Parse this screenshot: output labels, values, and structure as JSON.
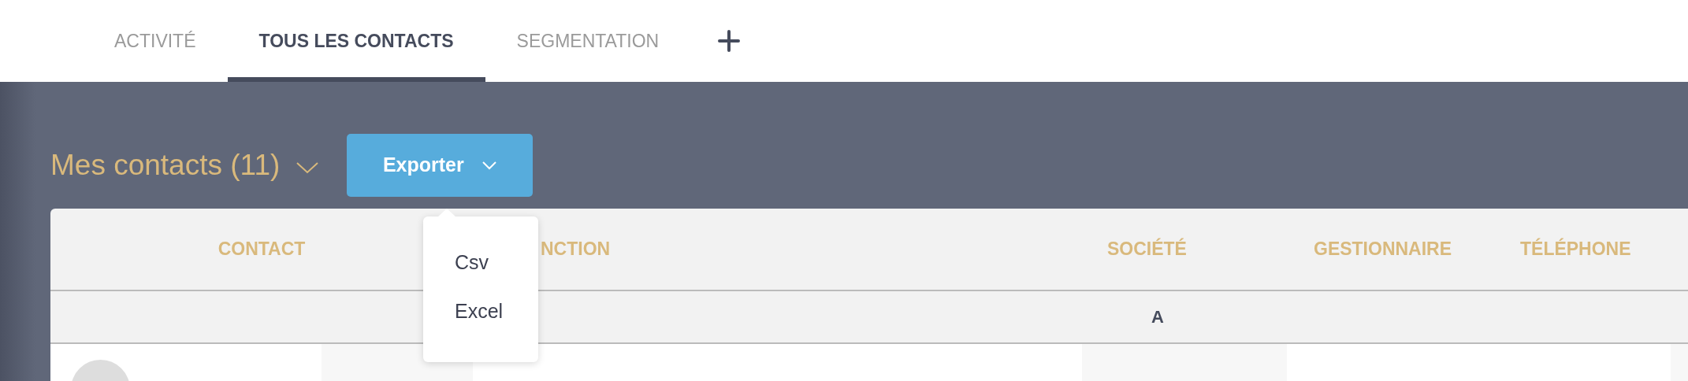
{
  "tabs": [
    {
      "label": "ACTIVITÉ",
      "selected": false
    },
    {
      "label": "TOUS LES CONTACTS",
      "selected": true
    },
    {
      "label": "SEGMENTATION",
      "selected": false
    }
  ],
  "list_selector": {
    "label": "Mes contacts (11)"
  },
  "export_button": {
    "label": "Exporter"
  },
  "export_menu": {
    "items": [
      "Csv",
      "Excel"
    ]
  },
  "table": {
    "columns": [
      "CONTACT",
      "NCTION",
      "SOCIÉTÉ",
      "GESTIONNAIRE",
      "TÉLÉPHONE"
    ],
    "groups": [
      {
        "letter": "A"
      }
    ]
  }
}
